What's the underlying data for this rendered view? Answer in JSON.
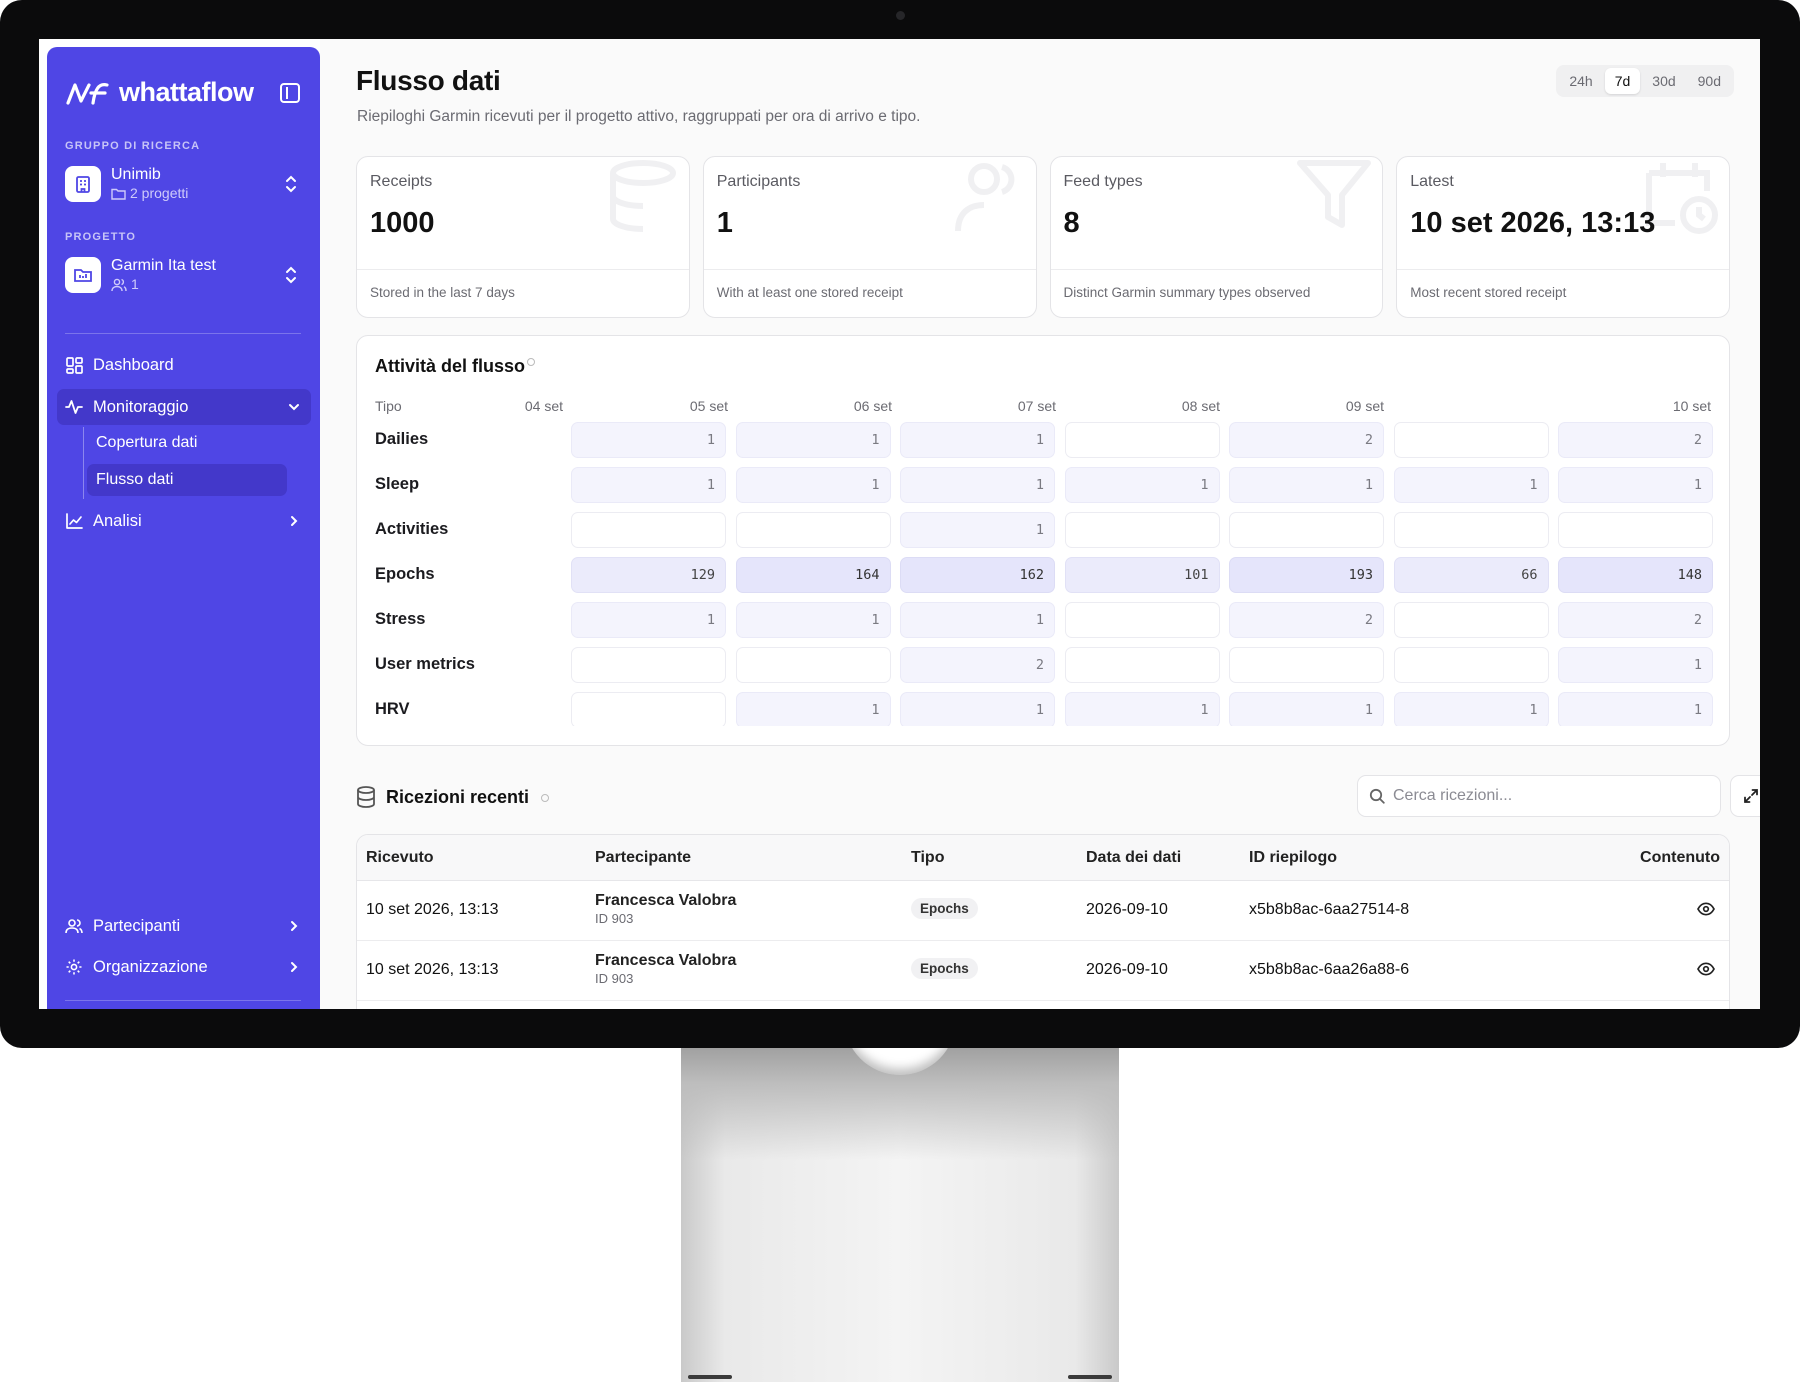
{
  "app": {
    "brand": "whattaflow"
  },
  "sidebar": {
    "group_section_label": "GRUPPO DI RICERCA",
    "group": {
      "name": "Unimib",
      "sub": "2 progetti"
    },
    "project_section_label": "PROGETTO",
    "project": {
      "name": "Garmin Ita test",
      "sub": "1"
    },
    "nav": {
      "dashboard": "Dashboard",
      "monitoring": "Monitoraggio",
      "coverage": "Copertura dati",
      "flow": "Flusso dati",
      "analysis": "Analisi",
      "participants": "Partecipanti",
      "organization": "Organizzazione"
    }
  },
  "header": {
    "title": "Flusso dati",
    "subtitle": "Riepiloghi Garmin ricevuti per il progetto attivo, raggruppati per ora di arrivo e tipo.",
    "ranges": [
      "24h",
      "7d",
      "30d",
      "90d"
    ],
    "selected_range": "7d"
  },
  "cards": [
    {
      "label": "Receipts",
      "value": "1000",
      "foot": "Stored in the last 7 days",
      "icon": "database-icon"
    },
    {
      "label": "Participants",
      "value": "1",
      "foot": "With at least one stored receipt",
      "icon": "users-icon"
    },
    {
      "label": "Feed types",
      "value": "8",
      "foot": "Distinct Garmin summary types observed",
      "icon": "filter-icon"
    },
    {
      "label": "Latest",
      "value": "10 set 2026, 13:13",
      "foot": "Most recent stored receipt",
      "icon": "calendar-clock-icon"
    }
  ],
  "activity": {
    "title": "Attività del flusso",
    "type_header": "Tipo",
    "days": [
      "04 set",
      "05 set",
      "06 set",
      "07 set",
      "08 set",
      "09 set",
      "10 set"
    ],
    "rows": [
      {
        "type": "Dailies",
        "counts": [
          "1",
          "1",
          "1",
          "",
          "2",
          "",
          "2"
        ]
      },
      {
        "type": "Sleep",
        "counts": [
          "1",
          "1",
          "1",
          "1",
          "1",
          "1",
          "1"
        ]
      },
      {
        "type": "Activities",
        "counts": [
          "",
          "",
          "1",
          "",
          "",
          "",
          ""
        ]
      },
      {
        "type": "Epochs",
        "counts": [
          "129",
          "164",
          "162",
          "101",
          "193",
          "66",
          "148"
        ]
      },
      {
        "type": "Stress",
        "counts": [
          "1",
          "1",
          "1",
          "",
          "2",
          "",
          "2"
        ]
      },
      {
        "type": "User metrics",
        "counts": [
          "",
          "",
          "2",
          "",
          "",
          "",
          "1"
        ]
      },
      {
        "type": "HRV",
        "counts": [
          "",
          "1",
          "1",
          "1",
          "1",
          "1",
          "1"
        ]
      }
    ]
  },
  "recent": {
    "title": "Ricezioni recenti",
    "search_placeholder": "Cerca ricezioni...",
    "columns": [
      "Ricevuto",
      "Partecipante",
      "Tipo",
      "Data dei dati",
      "ID riepilogo",
      "Contenuto"
    ],
    "rows": [
      {
        "received": "10 set 2026, 13:13",
        "participant": "Francesca Valobra",
        "participant_id": "ID 903",
        "type": "Epochs",
        "date": "2026-09-10",
        "summary_id": "x5b8b8ac-6aa27514-8"
      },
      {
        "received": "10 set 2026, 13:13",
        "participant": "Francesca Valobra",
        "participant_id": "ID 903",
        "type": "Epochs",
        "date": "2026-09-10",
        "summary_id": "x5b8b8ac-6aa26a88-6"
      }
    ]
  },
  "colors": {
    "sidebar_bg": "#4f46e5",
    "sidebar_active": "#4338ca",
    "heat_low": "#f4f4fd",
    "heat_high": "#e5e5fb"
  }
}
